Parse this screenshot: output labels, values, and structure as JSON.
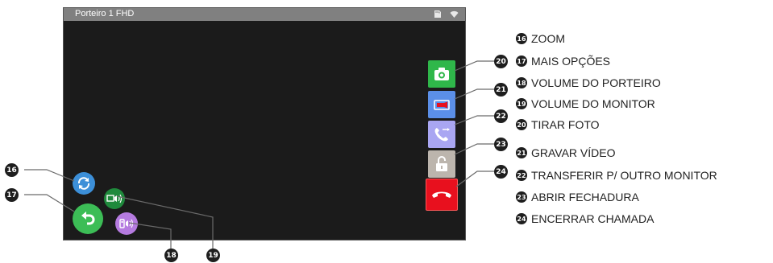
{
  "screen": {
    "title": "Porteiro 1   FHD",
    "status_icons": [
      "sd-card-icon",
      "wifi-icon"
    ]
  },
  "buttons": {
    "take_photo": {
      "icon": "camera-icon",
      "color": "#2fb74a"
    },
    "record_video": {
      "icon": "video-record-icon",
      "color": "#5b8fe8"
    },
    "transfer": {
      "icon": "phone-transfer-icon",
      "color": "#a9a6f2"
    },
    "unlock": {
      "icon": "unlock-icon",
      "color": "#bcb5ad"
    },
    "end_call": {
      "icon": "hangup-icon",
      "color": "#e8101e"
    },
    "zoom": {
      "icon": "zoom-icon",
      "color": "#3c8fd8"
    },
    "more_options": {
      "icon": "back-arrow-icon",
      "color": "#3cbd56"
    },
    "doorphone_volume": {
      "icon": "doorphone-volume-icon",
      "color": "#b57be0"
    },
    "monitor_volume": {
      "icon": "monitor-volume-icon",
      "color": "#1f8a3c"
    }
  },
  "callouts": [
    "16",
    "17",
    "18",
    "19",
    "20",
    "21",
    "22",
    "23",
    "24"
  ],
  "legend": [
    {
      "num": "16",
      "label": "ZOOM"
    },
    {
      "num": "17",
      "label": "MAIS OPÇÕES"
    },
    {
      "num": "18",
      "label": "VOLUME DO PORTEIRO"
    },
    {
      "num": "19",
      "label": "VOLUME DO MONITOR"
    },
    {
      "num": "20",
      "label": "TIRAR FOTO"
    },
    {
      "num": "21",
      "label": "GRAVAR VÍDEO"
    },
    {
      "num": "22",
      "label": "TRANSFERIR P/ OUTRO MONITOR"
    },
    {
      "num": "23",
      "label": "ABRIR FECHADURA"
    },
    {
      "num": "24",
      "label": "ENCERRAR CHAMADA"
    }
  ]
}
